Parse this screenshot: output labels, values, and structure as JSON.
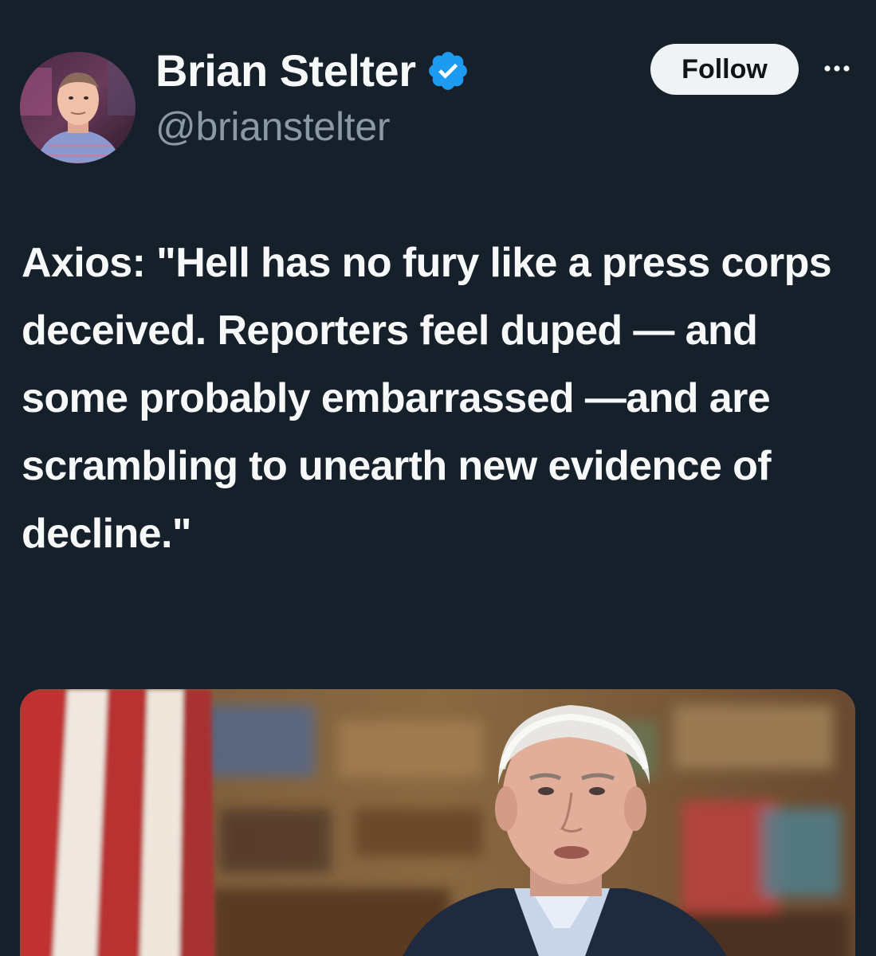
{
  "tweet": {
    "author": {
      "display_name": "Brian Stelter",
      "handle": "@brianstelter",
      "verified": true,
      "avatar_icon": "profile-photo"
    },
    "follow_label": "Follow",
    "more_icon": "more-horizontal-icon",
    "text": "Axios: \"Hell has no fury like a press corps deceived. Reporters feel duped — and some probably embarrassed —and are scrambling to unearth new evidence of decline.\"",
    "media": {
      "type": "photo"
    }
  },
  "colors": {
    "background": "#15202b",
    "text_primary": "#f7f9f9",
    "text_secondary": "#8b98a5",
    "verified_blue": "#1d9bf0",
    "follow_bg": "#eff3f4",
    "follow_text": "#0f1419"
  }
}
